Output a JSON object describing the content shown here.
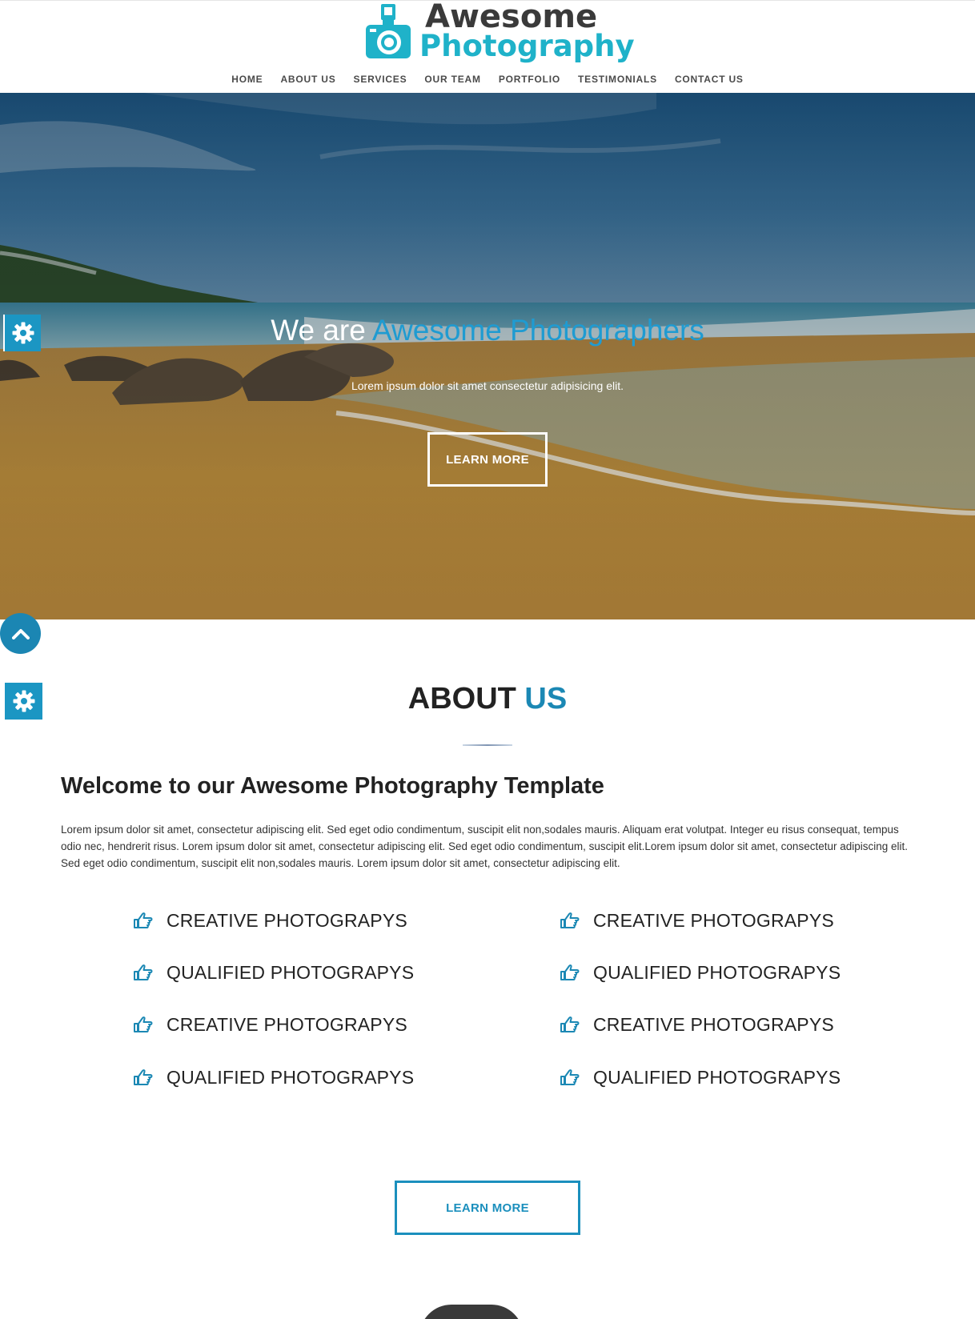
{
  "brand": {
    "line1": "Awesome",
    "line2": "Photography",
    "accent_color": "#1fb2c9"
  },
  "nav": {
    "items": [
      {
        "label": "HOME"
      },
      {
        "label": "ABOUT US"
      },
      {
        "label": "SERVICES"
      },
      {
        "label": "OUR TEAM"
      },
      {
        "label": "PORTFOLIO"
      },
      {
        "label": "TESTIMONIALS"
      },
      {
        "label": "CONTACT US"
      }
    ]
  },
  "hero": {
    "title_prefix": "We are ",
    "title_accent": "Awesome Photographers",
    "subtitle": "Lorem ipsum dolor sit amet consectetur adipisicing elit.",
    "button_label": "LEARN MORE"
  },
  "widgets": {
    "settings_icon": "gear-icon",
    "scroll_top_icon": "chevron-up-icon",
    "primary_color": "#1b96c3"
  },
  "about": {
    "title_prefix": "ABOUT ",
    "title_accent": "US",
    "heading": "Welcome to our Awesome Photography Template",
    "body": "Lorem ipsum dolor sit amet, consectetur adipiscing elit. Sed eget odio condimentum, suscipit elit non,sodales mauris. Aliquam erat volutpat. Integer eu risus consequat, tempus odio nec, hendrerit risus. Lorem ipsum dolor sit amet, consectetur adipiscing elit. Sed eget odio condimentum, suscipit elit.Lorem ipsum dolor sit amet, consectetur adipiscing elit. Sed eget odio condimentum, suscipit elit non,sodales mauris. Lorem ipsum dolor sit amet, consectetur adipiscing elit.",
    "features_left": [
      "CREATIVE PHOTOGRAPYS",
      "QUALIFIED PHOTOGRAPYS",
      "CREATIVE PHOTOGRAPYS",
      "QUALIFIED PHOTOGRAPYS"
    ],
    "features_right": [
      "CREATIVE PHOTOGRAPYS",
      "QUALIFIED PHOTOGRAPYS",
      "CREATIVE PHOTOGRAPYS",
      "QUALIFIED PHOTOGRAPYS"
    ],
    "feature_icon": "hand-pointing-right-icon",
    "button_label": "LEARN MORE",
    "accent_color": "#1b88b4"
  }
}
